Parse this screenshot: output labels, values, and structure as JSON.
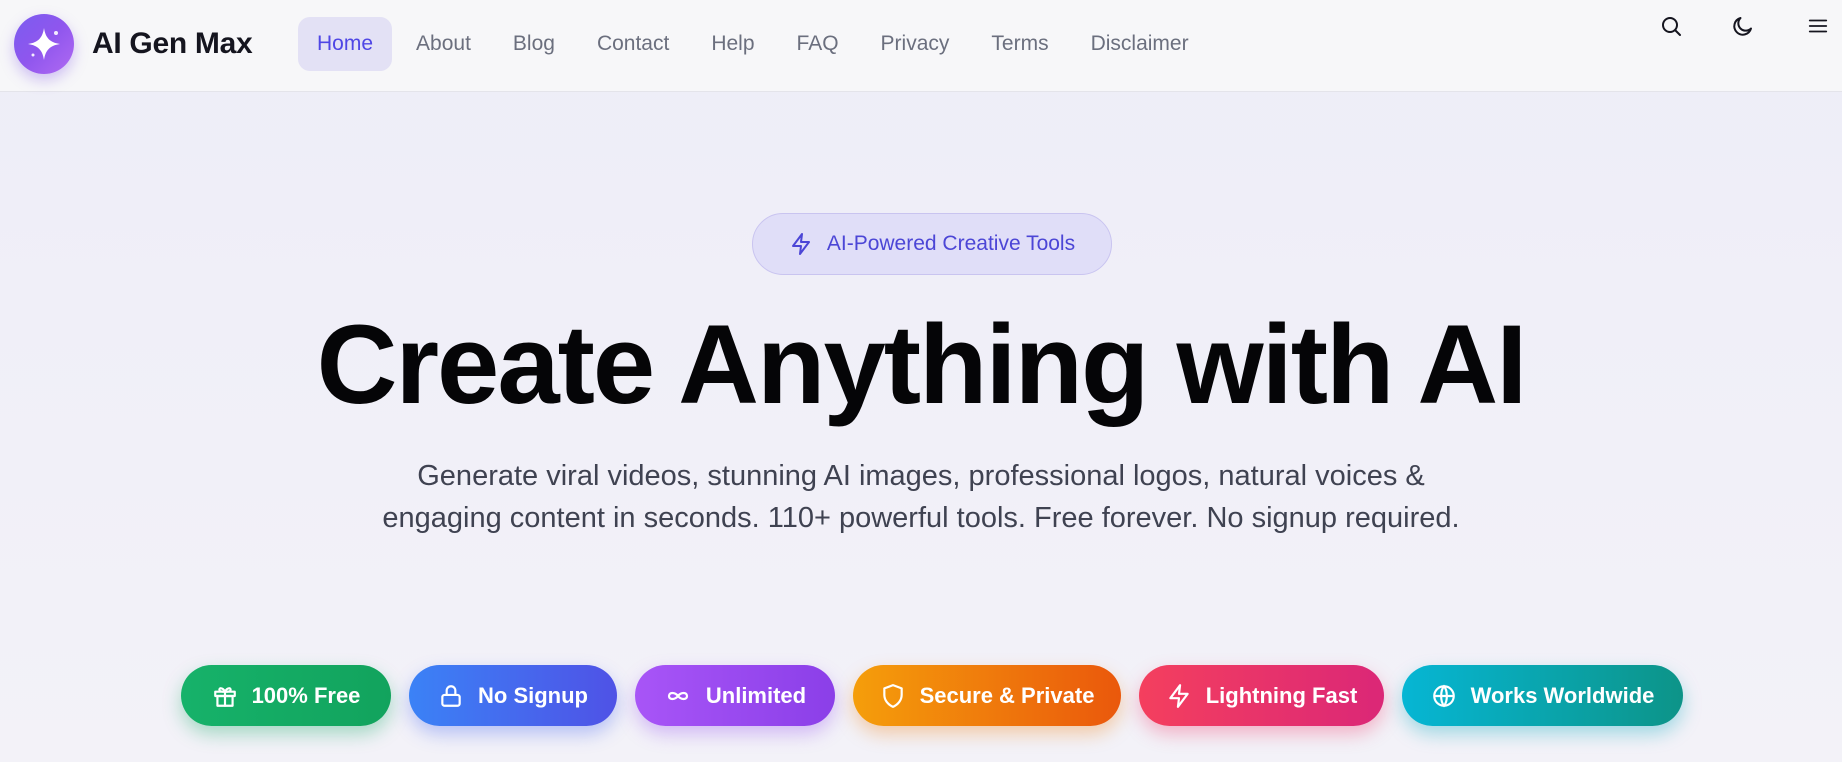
{
  "header": {
    "brand": "AI Gen Max",
    "nav": [
      {
        "label": "Home",
        "active": true
      },
      {
        "label": "About"
      },
      {
        "label": "Blog"
      },
      {
        "label": "Contact"
      },
      {
        "label": "Help"
      },
      {
        "label": "FAQ"
      },
      {
        "label": "Privacy"
      },
      {
        "label": "Terms"
      },
      {
        "label": "Disclaimer"
      }
    ],
    "icons": [
      "search-icon",
      "moon-icon",
      "menu-icon"
    ]
  },
  "hero": {
    "pill_label": "AI-Powered Creative Tools",
    "title": "Create Anything with AI",
    "subtitle": "Generate viral videos, stunning AI images, professional logos, natural voices & engaging content in seconds. 110+ powerful tools. Free forever. No signup required."
  },
  "badges": [
    {
      "label": "100% Free",
      "icon": "gift-icon",
      "color": "#16b26a"
    },
    {
      "label": "No Signup",
      "icon": "lock-icon",
      "color": "#3b82f6"
    },
    {
      "label": "Unlimited",
      "icon": "infinity-icon",
      "color": "#a855f7"
    },
    {
      "label": "Secure & Private",
      "icon": "shield-icon",
      "color": "#f59e0b"
    },
    {
      "label": "Lightning Fast",
      "icon": "bolt-icon",
      "color": "#f43f5e"
    },
    {
      "label": "Works Worldwide",
      "icon": "globe-icon",
      "color": "#06b6d4"
    }
  ],
  "colors": {
    "accent": "#4f46e5",
    "logo": "#8f56ee"
  }
}
